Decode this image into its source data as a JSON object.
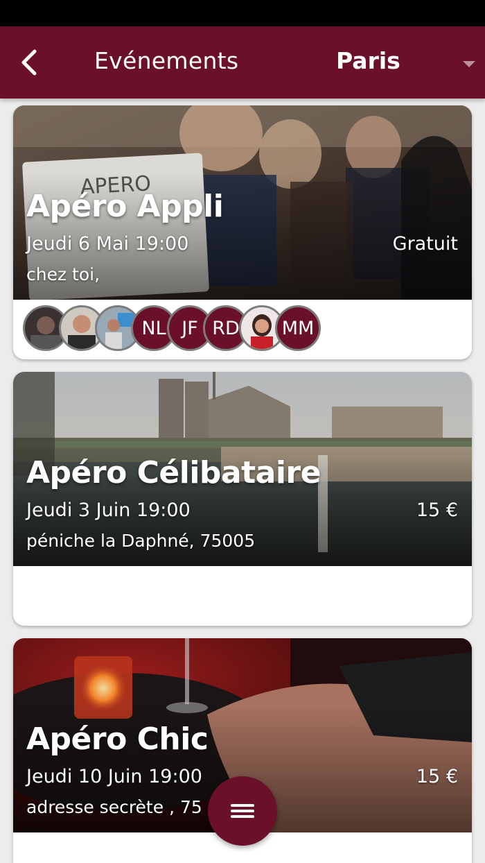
{
  "appbar": {
    "title": "Evénements",
    "city": "Paris",
    "back_icon": "chevron-left-icon",
    "city_dropdown_icon": "caret-down-icon",
    "color": "#6b1029"
  },
  "events": [
    {
      "title": "Apéro Appli",
      "date": "Jeudi 6 Mai 19:00",
      "price": "Gratuit",
      "address": "chez toi,",
      "participants": [
        {
          "type": "photo",
          "initials": ""
        },
        {
          "type": "photo",
          "initials": ""
        },
        {
          "type": "photo",
          "initials": ""
        },
        {
          "type": "initials",
          "initials": "NL"
        },
        {
          "type": "initials",
          "initials": "JF"
        },
        {
          "type": "initials",
          "initials": "RD"
        },
        {
          "type": "photo",
          "initials": ""
        },
        {
          "type": "initials",
          "initials": "MM"
        }
      ]
    },
    {
      "title": "Apéro Célibataire",
      "date": "Jeudi 3 Juin 19:00",
      "price": "15 €",
      "address": "péniche la Daphné, 75005",
      "participants": []
    },
    {
      "title": "Apéro Chic",
      "date": "Jeudi 10 Juin 19:00",
      "price": "15 €",
      "address": "adresse secrète , 75",
      "participants": []
    }
  ],
  "fab": {
    "icon": "menu-icon"
  }
}
